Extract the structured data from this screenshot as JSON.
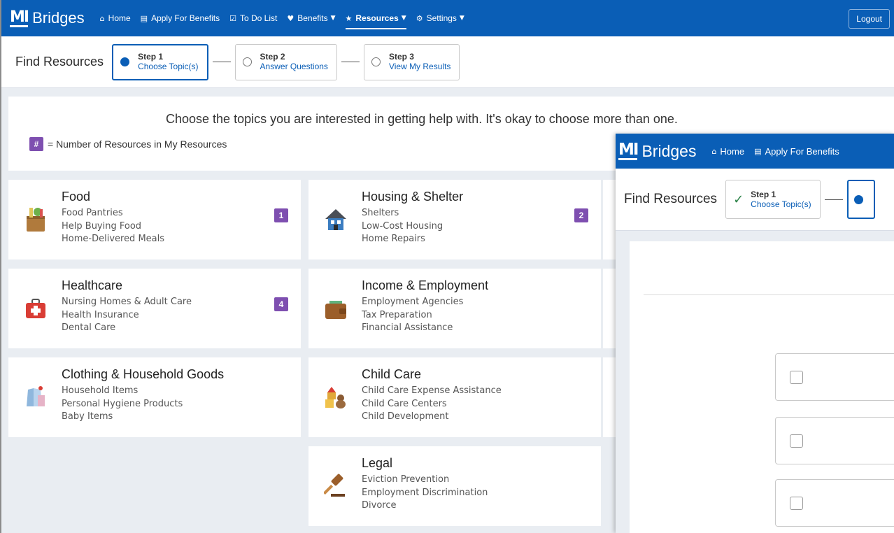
{
  "app": {
    "logo_mark": "MI",
    "logo_text": "Bridges"
  },
  "nav": {
    "home": "Home",
    "apply": "Apply For Benefits",
    "todo": "To Do List",
    "benefits": "Benefits",
    "resources": "Resources",
    "settings": "Settings",
    "logout": "Logout"
  },
  "stepbar": {
    "title": "Find Resources",
    "steps": [
      {
        "title": "Step 1",
        "subtitle": "Choose Topic(s)"
      },
      {
        "title": "Step 2",
        "subtitle": "Answer Questions"
      },
      {
        "title": "Step 3",
        "subtitle": "View My Results"
      }
    ]
  },
  "intro": {
    "text": "Choose the topics you are interested in getting help with. It's okay to choose more than one.",
    "legend_badge": "#",
    "legend_text": "= Number of Resources in My Resources"
  },
  "topics": [
    {
      "title": "Food",
      "items": [
        "Food Pantries",
        "Help Buying Food",
        "Home-Delivered Meals"
      ],
      "count": "1",
      "icon": "grocery-bag-icon"
    },
    {
      "title": "Housing & Shelter",
      "items": [
        "Shelters",
        "Low-Cost Housing",
        "Home Repairs"
      ],
      "count": "2",
      "icon": "house-icon"
    },
    {
      "title": "Healthcare",
      "items": [
        "Nursing Homes & Adult Care",
        "Health Insurance",
        "Dental Care"
      ],
      "count": "4",
      "icon": "first-aid-kit-icon"
    },
    {
      "title": "Income & Employment",
      "items": [
        "Employment Agencies",
        "Tax Preparation",
        "Financial Assistance"
      ],
      "count": "",
      "icon": "wallet-icon"
    },
    {
      "title": "Clothing & Household Goods",
      "items": [
        "Household Items",
        "Personal Hygiene Products",
        "Baby Items"
      ],
      "count": "",
      "icon": "clothing-icon"
    },
    {
      "title": "Child Care",
      "items": [
        "Child Care Expense Assistance",
        "Child Care Centers",
        "Child Development"
      ],
      "count": "",
      "icon": "toy-blocks-icon"
    },
    {
      "title": "Legal",
      "items": [
        "Eviction Prevention",
        "Employment Discrimination",
        "Divorce"
      ],
      "count": "",
      "icon": "gavel-icon"
    }
  ],
  "front_window": {
    "nav_home": "Home",
    "nav_apply": "Apply For Benefits",
    "stepbar_title": "Find Resources",
    "step1_title": "Step 1",
    "step1_subtitle": "Choose Topic(s)"
  },
  "colors": {
    "brand_blue": "#0a5eb6",
    "badge_purple": "#7e4fb0",
    "check_green": "#2e844a"
  }
}
